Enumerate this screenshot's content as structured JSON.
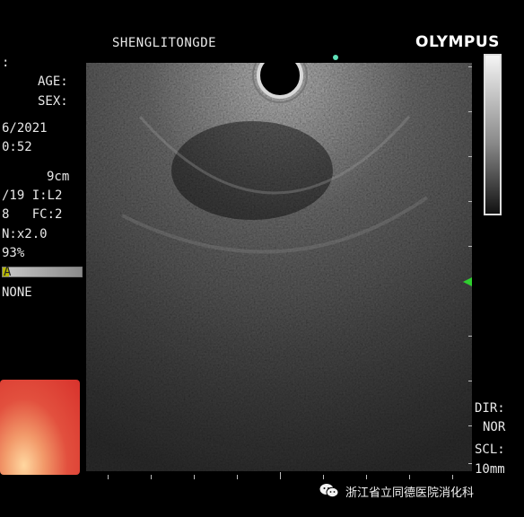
{
  "header": {
    "patient_name": "SHENGLITONGDE",
    "brand": "OLYMPUS"
  },
  "left_panel": {
    "lines": [
      ":",
      "AGE:",
      "SEX:",
      "6/2021",
      "0:52",
      "9cm",
      "/19 I:L2",
      "8   FC:2",
      "N:x2.0",
      "93%",
      "A",
      "NONE"
    ]
  },
  "right_panel": {
    "dir_label": "DIR:",
    "dir_value": "NOR",
    "scl_label": "SCL:",
    "scl_value": "10mm"
  },
  "gain": {
    "level_fraction": 0.08,
    "color": "#b8b800"
  },
  "marker": {
    "color": "#2fd02f"
  },
  "watermark": {
    "text": "浙江省立同德医院消化科"
  },
  "icons": {
    "watermark": "wechat-icon",
    "scale": "grayscale-bar-icon",
    "focus": "focus-marker-icon"
  }
}
